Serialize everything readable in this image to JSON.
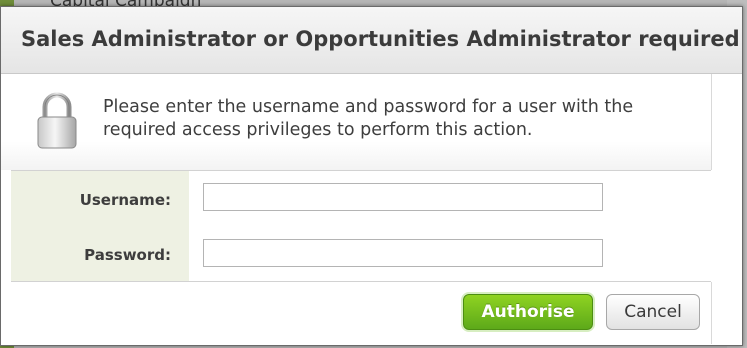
{
  "background": {
    "page_text": "Capital Campaign"
  },
  "dialog": {
    "title": "Sales Administrator or Opportunities Administrator required",
    "message_line1": "Please enter the username and password for a user with the",
    "message_line2": "required access privileges to perform this action.",
    "icon": "lock-icon",
    "fields": {
      "username_label": "Username:",
      "username_value": "",
      "password_label": "Password:",
      "password_value": ""
    },
    "buttons": {
      "authorise_label": "Authorise",
      "cancel_label": "Cancel"
    },
    "colors": {
      "primary_button": "#6cbb1d",
      "label_column": "#eef1e3"
    }
  }
}
